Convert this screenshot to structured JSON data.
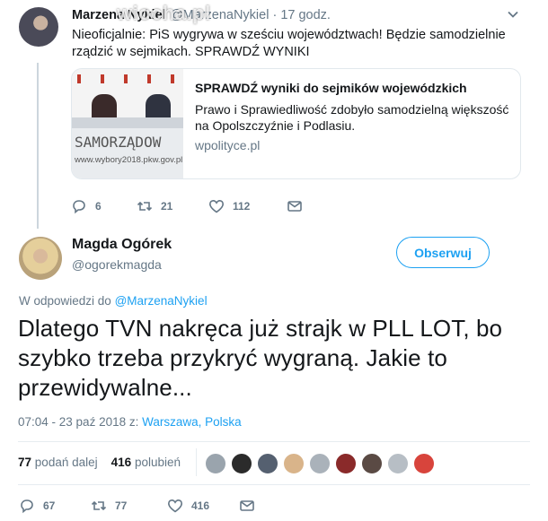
{
  "parent": {
    "name": "Marzena Nykiel",
    "handle": "@MarzenaNykiel",
    "time": "· 17 godz.",
    "watermark": "wiocha.pl",
    "text": "Nieoficjalnie: PiS wygrywa w sześciu województwach! Będzie samodzielnie rządzić w sejmikach. SPRAWDŹ WYNIKI",
    "card": {
      "image_text": "SAMORZĄDOW",
      "image_url_text": "www.wybory2018.pkw.gov.pl",
      "title": "SPRAWDŹ wyniki do sejmików wojewódzkich",
      "description": "Prawo i Sprawiedliwość zdobyło samodzielną większość na Opolszczyźnie i Podlasiu.",
      "domain": "wpolityce.pl"
    },
    "actions": {
      "replies": "6",
      "retweets": "21",
      "likes": "112"
    }
  },
  "tweet": {
    "name": "Magda Ogórek",
    "handle": "@ogorekmagda",
    "follow_label": "Obserwuj",
    "reply_prefix": "W odpowiedzi do",
    "reply_handle": "@MarzenaNykiel",
    "text": "Dlatego TVN nakręca już strajk w PLL LOT, bo szybko trzeba przykryć wygraną. Jakie to przewidywalne...",
    "timestamp": "07:04 - 23 paź 2018 z:",
    "location": "Warszawa, Polska",
    "retweets_count": "77",
    "retweets_label": "podań dalej",
    "likes_count": "416",
    "likes_label": "polubień",
    "actions": {
      "replies": "67",
      "retweets": "77",
      "likes": "416"
    }
  },
  "likers": [
    "#9aa4ad",
    "#2b2b2b",
    "#556070",
    "#d9b48a",
    "#aab2ba",
    "#8a2a2a",
    "#5a4a44",
    "#b7bec5",
    "#d8443c"
  ],
  "colors": {
    "accent": "#1da1f2",
    "secondary_text": "#657786",
    "text": "#14171a"
  },
  "icons": [
    "reply-icon",
    "retweet-icon",
    "like-icon",
    "message-icon",
    "chevron-down-icon"
  ]
}
